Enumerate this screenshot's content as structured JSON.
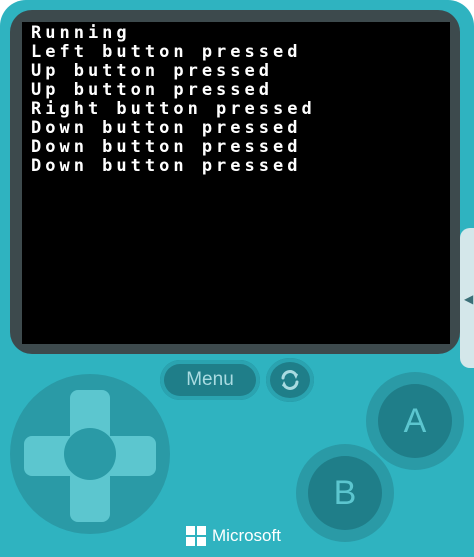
{
  "console": {
    "lines": [
      "Running",
      "Left button pressed",
      "Up button pressed",
      "Up button pressed",
      "Right button pressed",
      "Down button pressed",
      "Down button pressed",
      "Down button pressed"
    ]
  },
  "controls": {
    "menu_label": "Menu",
    "restart_icon": "restart-icon",
    "a_label": "A",
    "b_label": "B"
  },
  "brand": {
    "name": "Microsoft",
    "logo_icon": "microsoft-logo-icon"
  },
  "colors": {
    "device": "#2fb3c0",
    "bezel": "#3d4a4d",
    "screen": "#000000",
    "button_face": "#1f7e89",
    "accent_light": "#5cc6cf"
  }
}
